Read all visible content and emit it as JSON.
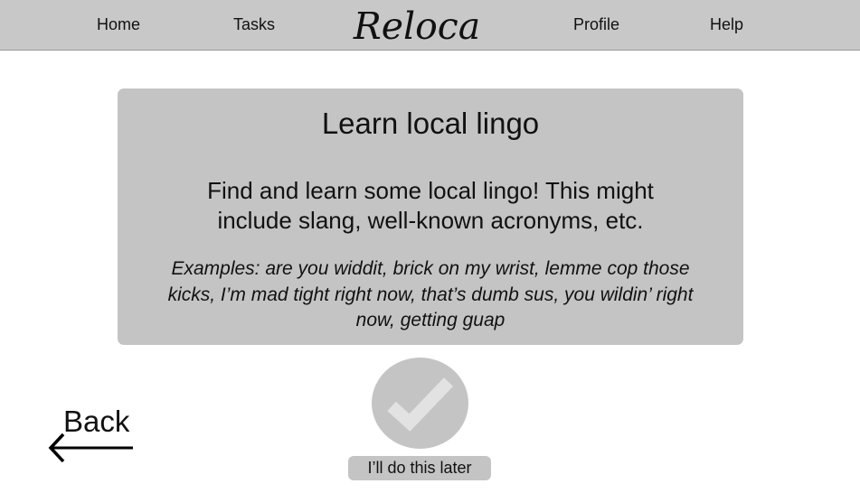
{
  "nav": {
    "home": "Home",
    "tasks": "Tasks",
    "logo": "Reloca",
    "profile": "Profile",
    "help": "Help"
  },
  "task": {
    "title": "Learn local lingo",
    "description": "Find and learn some local lingo! This might include slang, well-known acronyms, etc.",
    "examples": "Examples: are you widdit, brick on my wrist, lemme cop those kicks, I’m mad tight right now, that’s dumb sus, you wildin’ right now, getting guap"
  },
  "actions": {
    "complete_icon": "checkmark-icon",
    "later_label": "I’ll do this later",
    "back_label": "Back",
    "back_icon": "arrow-left-icon"
  },
  "colors": {
    "nav_background": "#c8c8c8",
    "card_background": "#c4c4c4",
    "checkmark": "#e2e2e2"
  }
}
